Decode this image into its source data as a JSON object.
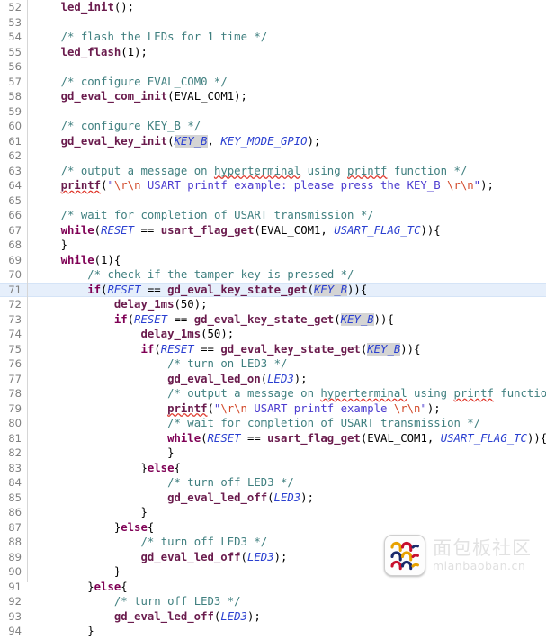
{
  "editor": {
    "language": "c",
    "first_line_number": 52,
    "current_line_number": 71,
    "colors": {
      "background": "#ffffff",
      "gutter_text": "#808080",
      "gutter_rule": "#d6d6d6",
      "current_line_highlight": "#e6effb",
      "comment": "#3f7f7f",
      "keyword": "#7f0055",
      "function": "#6a1b4d",
      "macro_constant": "#2a3fd0",
      "string": "#4b3bcf",
      "escape": "#d2492a",
      "occurrence_highlight": "#d4d4d4",
      "spellcheck_underline": "#e03a2f"
    },
    "lines": [
      {
        "n": 52,
        "text": "    led_init();"
      },
      {
        "n": 53,
        "text": ""
      },
      {
        "n": 54,
        "text": "    /* flash the LEDs for 1 time */"
      },
      {
        "n": 55,
        "text": "    led_flash(1);"
      },
      {
        "n": 56,
        "text": ""
      },
      {
        "n": 57,
        "text": "    /* configure EVAL_COM0 */"
      },
      {
        "n": 58,
        "text": "    gd_eval_com_init(EVAL_COM1);"
      },
      {
        "n": 59,
        "text": ""
      },
      {
        "n": 60,
        "text": "    /* configure KEY_B */"
      },
      {
        "n": 61,
        "text": "    gd_eval_key_init(KEY_B, KEY_MODE_GPIO);"
      },
      {
        "n": 62,
        "text": ""
      },
      {
        "n": 63,
        "text": "    /* output a message on hyperterminal using printf function */"
      },
      {
        "n": 64,
        "text": "    printf(\"\\r\\n USART printf example: please press the KEY_B \\r\\n\");"
      },
      {
        "n": 65,
        "text": ""
      },
      {
        "n": 66,
        "text": "    /* wait for completion of USART transmission */"
      },
      {
        "n": 67,
        "text": "    while(RESET == usart_flag_get(EVAL_COM1, USART_FLAG_TC)){"
      },
      {
        "n": 68,
        "text": "    }"
      },
      {
        "n": 69,
        "text": "    while(1){"
      },
      {
        "n": 70,
        "text": "        /* check if the tamper key is pressed */"
      },
      {
        "n": 71,
        "text": "        if(RESET == gd_eval_key_state_get(KEY_B)){"
      },
      {
        "n": 72,
        "text": "            delay_1ms(50);"
      },
      {
        "n": 73,
        "text": "            if(RESET == gd_eval_key_state_get(KEY_B)){"
      },
      {
        "n": 74,
        "text": "                delay_1ms(50);"
      },
      {
        "n": 75,
        "text": "                if(RESET == gd_eval_key_state_get(KEY_B)){"
      },
      {
        "n": 76,
        "text": "                    /* turn on LED3 */"
      },
      {
        "n": 77,
        "text": "                    gd_eval_led_on(LED3);"
      },
      {
        "n": 78,
        "text": "                    /* output a message on hyperterminal using printf function */"
      },
      {
        "n": 79,
        "text": "                    printf(\"\\r\\n USART printf example \\r\\n\");"
      },
      {
        "n": 80,
        "text": "                    /* wait for completion of USART transmission */"
      },
      {
        "n": 81,
        "text": "                    while(RESET == usart_flag_get(EVAL_COM1, USART_FLAG_TC)){"
      },
      {
        "n": 82,
        "text": "                    }"
      },
      {
        "n": 83,
        "text": "                }else{"
      },
      {
        "n": 84,
        "text": "                    /* turn off LED3 */"
      },
      {
        "n": 85,
        "text": "                    gd_eval_led_off(LED3);"
      },
      {
        "n": 86,
        "text": "                }"
      },
      {
        "n": 87,
        "text": "            }else{"
      },
      {
        "n": 88,
        "text": "                /* turn off LED3 */"
      },
      {
        "n": 89,
        "text": "                gd_eval_led_off(LED3);"
      },
      {
        "n": 90,
        "text": "            }"
      },
      {
        "n": 91,
        "text": "        }else{"
      },
      {
        "n": 92,
        "text": "            /* turn off LED3 */"
      },
      {
        "n": 93,
        "text": "            gd_eval_led_off(LED3);"
      },
      {
        "n": 94,
        "text": "        }"
      }
    ],
    "tokens": {
      "keywords": [
        "while",
        "if",
        "else"
      ],
      "macros": [
        "KEY_B",
        "KEY_MODE_GPIO",
        "RESET",
        "USART_FLAG_TC",
        "LED3"
      ],
      "occurrence_highlighted": "KEY_B",
      "spellcheck_words": [
        "hyperterminal",
        "printf"
      ]
    }
  },
  "watermark": {
    "logo_name": "mianbaoban-logo-icon",
    "title_cn": "面包板社区",
    "title_en": "mianbaoban.cn"
  }
}
